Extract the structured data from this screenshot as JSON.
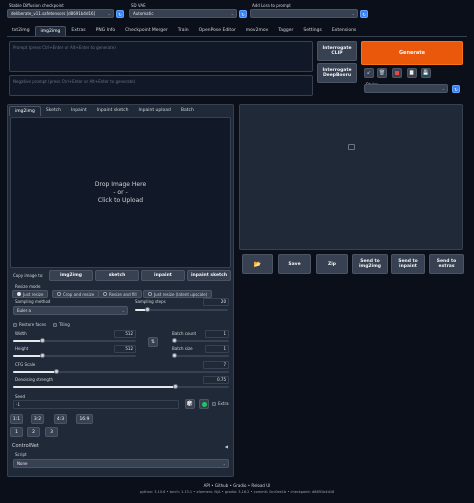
{
  "top": {
    "checkpoint_label": "Stable Diffusion checkpoint",
    "checkpoint_value": "deliberate_v11.safetensors [d8691b4d16]",
    "vae_label": "SD VAE",
    "vae_value": "Automatic",
    "lora_label": "Add Lora to prompt",
    "lora_value": ""
  },
  "main_tabs": [
    "txt2img",
    "img2img",
    "Extras",
    "PNG Info",
    "Checkpoint Merger",
    "Train",
    "OpenPose Editor",
    "mov2mov",
    "Tagger",
    "Settings",
    "Extensions"
  ],
  "prompt": {
    "placeholder": "Prompt (press Ctrl+Enter or Alt+Enter to generate)",
    "negative_placeholder": "Negative prompt (press Ctrl+Enter or Alt+Enter to generate)"
  },
  "interrogate_clip": "Interrogate CLIP",
  "interrogate_deepbooru": "Interrogate DeepBooru",
  "generate_label": "Generate",
  "styles_label": "Styles",
  "img_tabs": [
    "img2img",
    "Sketch",
    "Inpaint",
    "Inpaint sketch",
    "Inpaint upload",
    "Batch"
  ],
  "drop": {
    "line1": "Drop Image Here",
    "line2": "- or -",
    "line3": "Click to Upload"
  },
  "copy_to": {
    "label": "Copy image to:",
    "buttons": [
      "img2img",
      "sketch",
      "inpaint",
      "inpaint sketch"
    ]
  },
  "output_buttons": [
    "Save",
    "Zip",
    "Send to img2img",
    "Send to inpaint",
    "Send to extras"
  ],
  "resize": {
    "label": "Resize mode",
    "options": [
      "Just resize",
      "Crop and resize",
      "Resize and fill",
      "Just resize (latent upscale)"
    ],
    "selected": 0
  },
  "sampling_method": {
    "label": "Sampling method",
    "value": "Euler a"
  },
  "sampling_steps": {
    "label": "Sampling steps",
    "value": "20",
    "fraction": 0.13
  },
  "restore_faces": "Restore faces",
  "tiling": "Tiling",
  "width": {
    "label": "Width",
    "value": "512",
    "fraction": 0.24
  },
  "height": {
    "label": "Height",
    "value": "512",
    "fraction": 0.24
  },
  "batch_count": {
    "label": "Batch count",
    "value": "1",
    "fraction": 0.0
  },
  "batch_size": {
    "label": "Batch size",
    "value": "1",
    "fraction": 0.0
  },
  "cfg_scale": {
    "label": "CFG Scale",
    "value": "7",
    "fraction": 0.2
  },
  "denoising": {
    "label": "Denoising strength",
    "value": "0.75",
    "fraction": 0.75
  },
  "seed": {
    "label": "Seed",
    "value": "-1",
    "extra": "Extra"
  },
  "aspect_ratios": [
    "1:1",
    "3:2",
    "4:3",
    "16:9"
  ],
  "multipliers": [
    "1",
    "2",
    "3"
  ],
  "controlnet": {
    "label": "ControlNet",
    "script_label": "Script",
    "script_value": "None"
  },
  "footer": {
    "links": [
      "API",
      "Github",
      "Gradio",
      "Reload UI"
    ],
    "info": "python: 3.10.6  •  torch: 1.13.1  •  xformers: N/A  •  gradio: 3.16.2  •  commit: 0cc0ee1b  •  checkpoint: d8691b4d16"
  },
  "colors": {
    "generate": "#ea580c",
    "background": "#0b0f19",
    "panel": "#1f2937"
  }
}
